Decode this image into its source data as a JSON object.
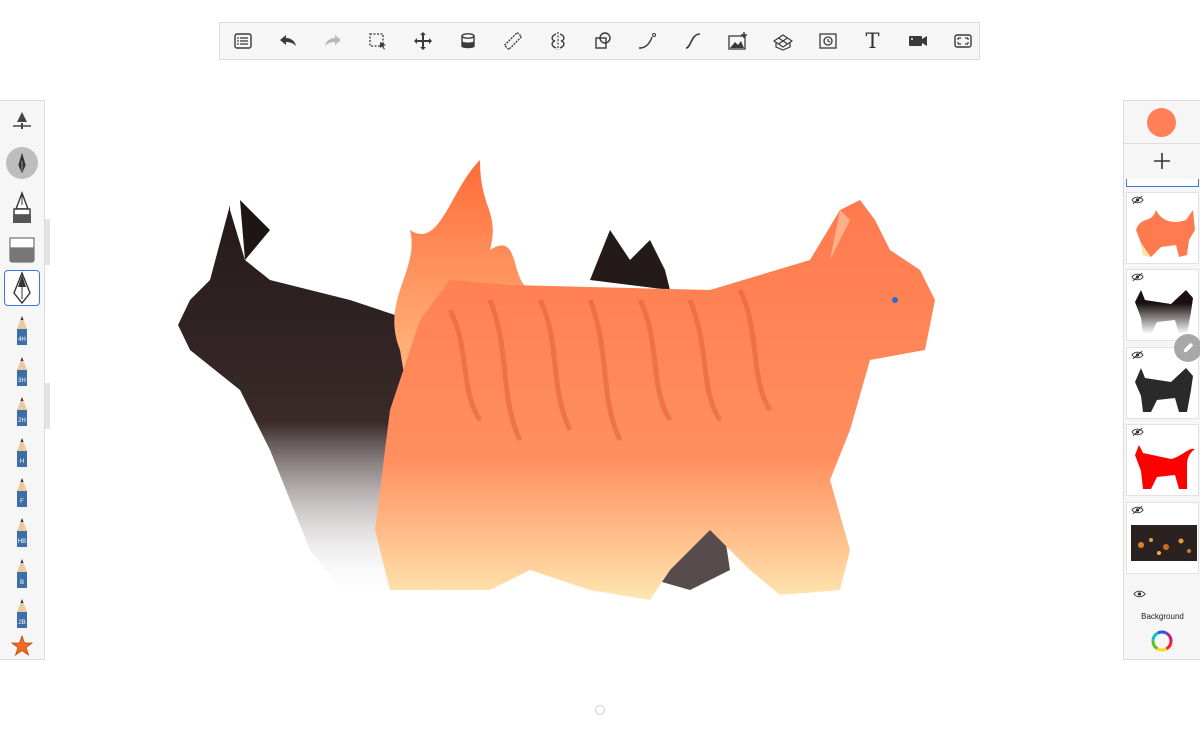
{
  "colors": {
    "current_color": "#ff8059",
    "accent": "#3b7bd6"
  },
  "toolbar": {
    "items": [
      {
        "name": "layers-list-icon"
      },
      {
        "name": "undo-icon"
      },
      {
        "name": "redo-icon"
      },
      {
        "name": "selection-icon"
      },
      {
        "name": "transform-icon"
      },
      {
        "name": "fill-icon"
      },
      {
        "name": "ruler-icon"
      },
      {
        "name": "symmetry-icon"
      },
      {
        "name": "shapes-icon"
      },
      {
        "name": "curve-icon"
      },
      {
        "name": "stroke-icon"
      },
      {
        "name": "import-image-icon"
      },
      {
        "name": "perspective-icon"
      },
      {
        "name": "time-lapse-icon"
      },
      {
        "name": "text-icon"
      },
      {
        "name": "video-icon"
      },
      {
        "name": "fullscreen-icon"
      }
    ],
    "text_tool_label": "T"
  },
  "brushes": [
    {
      "name": "brush-properties-icon"
    },
    {
      "name": "brush-size-puck"
    },
    {
      "name": "ink-pen-icon"
    },
    {
      "name": "eraser-icon"
    },
    {
      "name": "fineliner-icon",
      "selected": true
    },
    {
      "name": "pencil-4h",
      "label": "4H"
    },
    {
      "name": "pencil-3h",
      "label": "3H"
    },
    {
      "name": "pencil-2h",
      "label": "2H"
    },
    {
      "name": "pencil-h",
      "label": "H"
    },
    {
      "name": "pencil-f",
      "label": "F"
    },
    {
      "name": "pencil-hb",
      "label": "HB"
    },
    {
      "name": "pencil-b",
      "label": "B"
    },
    {
      "name": "pencil-2b",
      "label": "2B"
    },
    {
      "name": "favorites-star-icon"
    }
  ],
  "layers": {
    "items": [
      {
        "name": "layer-orange-cat",
        "visible": false
      },
      {
        "name": "layer-black-cat-gradient",
        "visible": false
      },
      {
        "name": "layer-black-cat-silhouette",
        "visible": false
      },
      {
        "name": "layer-red-cat-silhouette",
        "visible": false
      },
      {
        "name": "layer-photo",
        "visible": false
      }
    ],
    "background_label": "Background"
  }
}
